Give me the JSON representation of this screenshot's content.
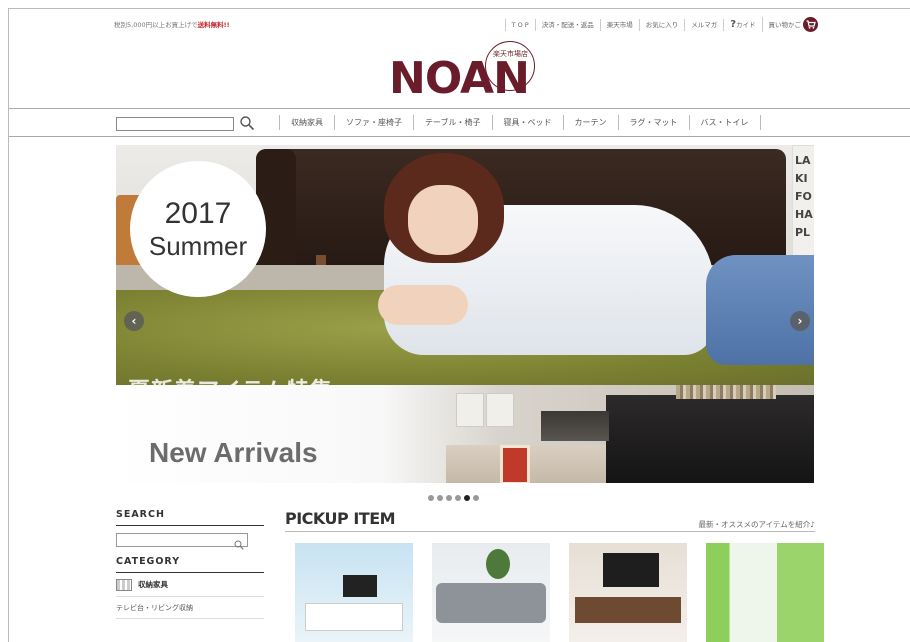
{
  "header": {
    "promo_prefix": "税別5,000円以上お買上げで",
    "promo_highlight": "送料無料!!",
    "links": [
      "T O P",
      "決済・配送・返品",
      "楽天市場",
      "お気に入り",
      "メルマガ",
      "カイド",
      "買い物かご"
    ],
    "guide_mark": "?",
    "logo_text": "NOAN",
    "logo_sub": "楽天市場店"
  },
  "nav": {
    "search_placeholder": "",
    "items": [
      "収納家具",
      "ソファ・座椅子",
      "テーブル・椅子",
      "寝具・ベッド",
      "カーテン",
      "ラグ・マット",
      "バス・トイレ"
    ]
  },
  "hero": {
    "badge_year": "2017",
    "badge_season": "Summer",
    "ghost_text": "夏新着アイテム特集",
    "sign_text": "LA\nKI\nFO\nHA\nPL",
    "banner_title": "New Arrivals",
    "prev_label": "‹",
    "next_label": "›",
    "slide_count": 6,
    "active_slide": 5
  },
  "sidebar": {
    "search_heading": "SEARCH",
    "category_heading": "CATEGORY",
    "category_item": "収納家具",
    "sub_item": "テレビ台・リビング収納"
  },
  "pickup": {
    "title": "PICKUP ITEM",
    "subtitle": "最新・オススメのアイテムを紹介♪"
  },
  "colors": {
    "brand": "#6b1c2a",
    "promo_red": "#c0282e"
  }
}
